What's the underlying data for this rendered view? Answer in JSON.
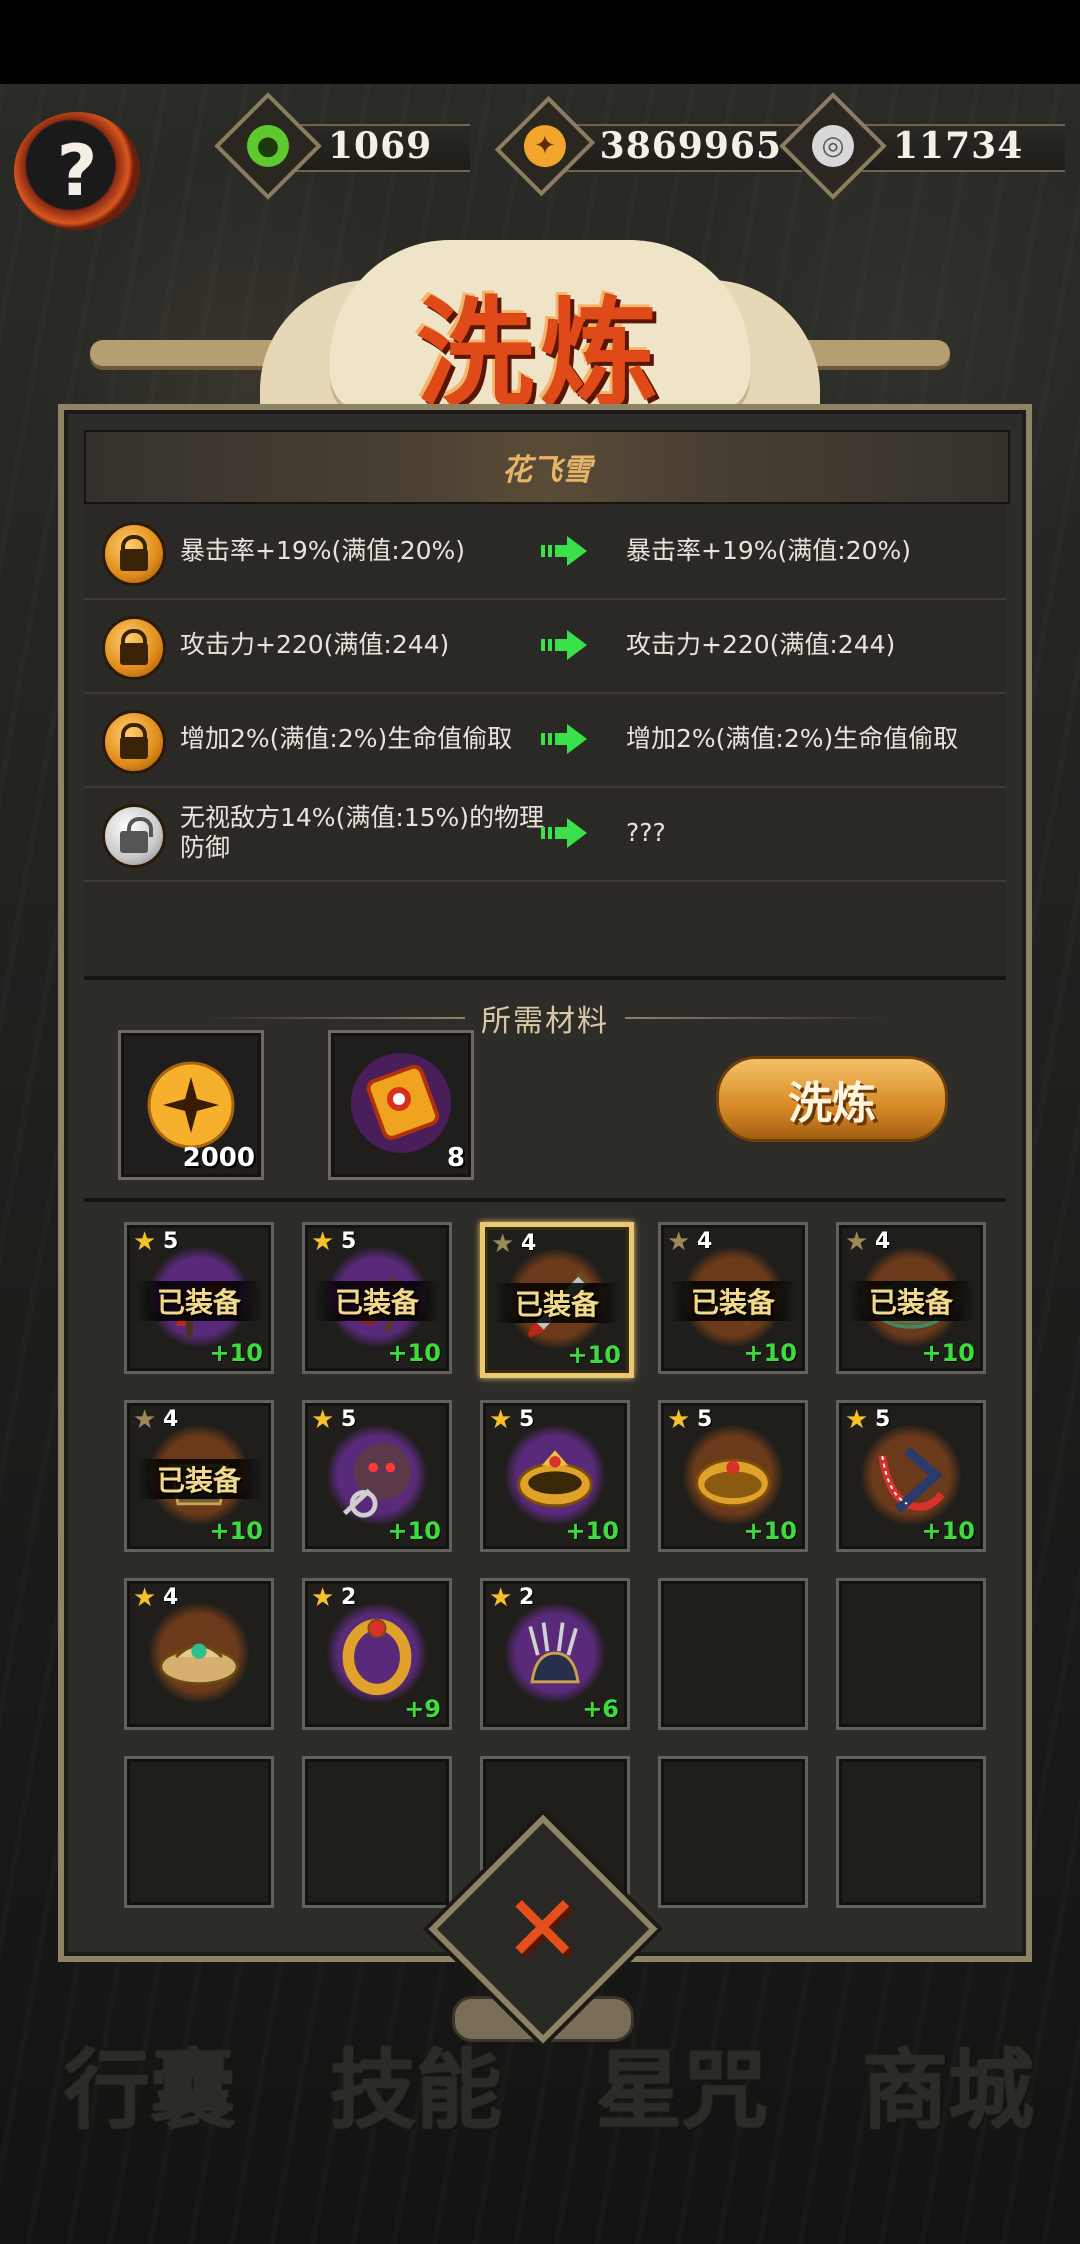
{
  "resources": [
    {
      "icon": "jade-drop-icon",
      "value": "1069",
      "color": "#5ec92c"
    },
    {
      "icon": "gold-coin-icon",
      "value": "3869965",
      "color": "#f3a52b"
    },
    {
      "icon": "silver-coin-icon",
      "value": "11734",
      "color": "#c9c9c9"
    }
  ],
  "help_label": "?",
  "title": "洗炼",
  "item_name": "花飞雪",
  "attributes": [
    {
      "locked": true,
      "current": "暴击率+19%(满值:20%)",
      "result": "暴击率+19%(满值:20%)"
    },
    {
      "locked": true,
      "current": "攻击力+220(满值:244)",
      "result": "攻击力+220(满值:244)"
    },
    {
      "locked": true,
      "current": "增加2%(满值:2%)生命值偷取",
      "result": "增加2%(满值:2%)生命值偷取"
    },
    {
      "locked": false,
      "current": "无视敌方14%(满值:15%)的物理防御",
      "result": "???"
    }
  ],
  "materials_title": "所需材料",
  "materials": [
    {
      "icon": "gold-coin-icon",
      "count": "2000"
    },
    {
      "icon": "scroll-icon",
      "count": "8"
    }
  ],
  "wash_button": "洗炼",
  "equipped_label": "已装备",
  "items": [
    {
      "stars": "5",
      "plus": "+10",
      "equipped": true,
      "selected": false,
      "glow": "#5a2a7a",
      "icon": "red-sickle-icon"
    },
    {
      "stars": "5",
      "plus": "+10",
      "equipped": true,
      "selected": false,
      "glow": "#5a2a7a",
      "icon": "whip-icon"
    },
    {
      "stars": "4",
      "plus": "+10",
      "equipped": true,
      "selected": true,
      "glow": "#6a3a1a",
      "icon": "dagger-icon"
    },
    {
      "stars": "4",
      "plus": "+10",
      "equipped": true,
      "selected": false,
      "glow": "#6a3a1a",
      "icon": "shoulder-armor-icon"
    },
    {
      "stars": "4",
      "plus": "+10",
      "equipped": true,
      "selected": false,
      "glow": "#6a3a1a",
      "icon": "jade-bracelet-icon"
    },
    {
      "stars": "4",
      "plus": "+10",
      "equipped": true,
      "selected": false,
      "glow": "#6a3a1a",
      "icon": "armor-icon"
    },
    {
      "stars": "5",
      "plus": "+10",
      "equipped": false,
      "selected": false,
      "glow": "#5a2a7a",
      "icon": "demon-mace-icon"
    },
    {
      "stars": "5",
      "plus": "+10",
      "equipped": false,
      "selected": false,
      "glow": "#5a2a7a",
      "icon": "gold-crown-ring-icon"
    },
    {
      "stars": "5",
      "plus": "+10",
      "equipped": false,
      "selected": false,
      "glow": "#6a3a1a",
      "icon": "ruby-ring-icon"
    },
    {
      "stars": "5",
      "plus": "+10",
      "equipped": false,
      "selected": false,
      "glow": "#6a3a1a",
      "icon": "red-rope-icon"
    },
    {
      "stars": "4",
      "plus": "",
      "equipped": false,
      "selected": false,
      "glow": "#6a3a1a",
      "icon": "emerald-crown-icon"
    },
    {
      "stars": "2",
      "plus": "+9",
      "equipped": false,
      "selected": false,
      "glow": "#5a2a7a",
      "icon": "gold-ring-icon"
    },
    {
      "stars": "2",
      "plus": "+6",
      "equipped": false,
      "selected": false,
      "glow": "#5a2a7a",
      "icon": "claw-glove-icon"
    },
    null,
    null,
    null,
    null,
    null,
    null,
    null
  ],
  "close_label": "✕",
  "bottom_nav": [
    "行囊",
    "技能",
    "星咒",
    "商城"
  ]
}
